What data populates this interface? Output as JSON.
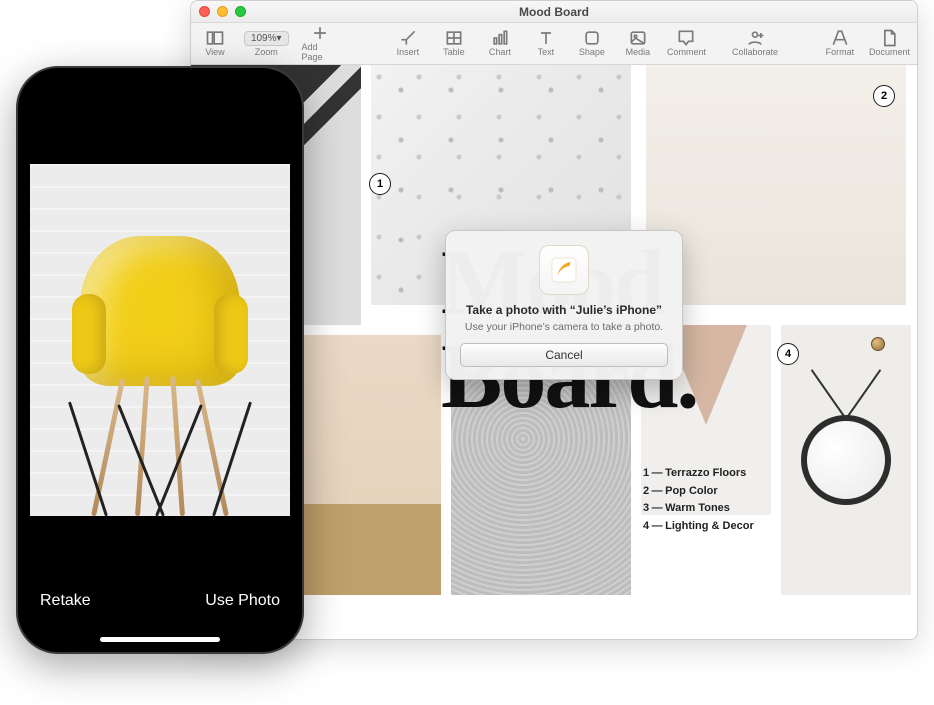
{
  "mac": {
    "title": "Mood Board",
    "toolbar": {
      "view": "View",
      "zoom_value": "109%",
      "zoom": "Zoom",
      "add_page": "Add Page",
      "insert": "Insert",
      "table": "Table",
      "chart": "Chart",
      "text": "Text",
      "shape": "Shape",
      "media": "Media",
      "comment": "Comment",
      "collaborate": "Collaborate",
      "format": "Format",
      "document": "Document"
    },
    "document": {
      "big_text_line1": "Mood",
      "big_text_line2": "Board.",
      "markers": {
        "m1": "1",
        "m2": "2",
        "m4": "4"
      },
      "legend": [
        {
          "n": "1",
          "label": "Terrazzo Floors"
        },
        {
          "n": "2",
          "label": "Pop Color"
        },
        {
          "n": "3",
          "label": "Warm Tones"
        },
        {
          "n": "4",
          "label": "Lighting & Decor"
        }
      ]
    }
  },
  "dialog": {
    "title": "Take a photo with “Julie’s iPhone”",
    "subtitle": "Use your iPhone’s camera to take a photo.",
    "cancel": "Cancel"
  },
  "phone": {
    "retake": "Retake",
    "use_photo": "Use Photo"
  }
}
